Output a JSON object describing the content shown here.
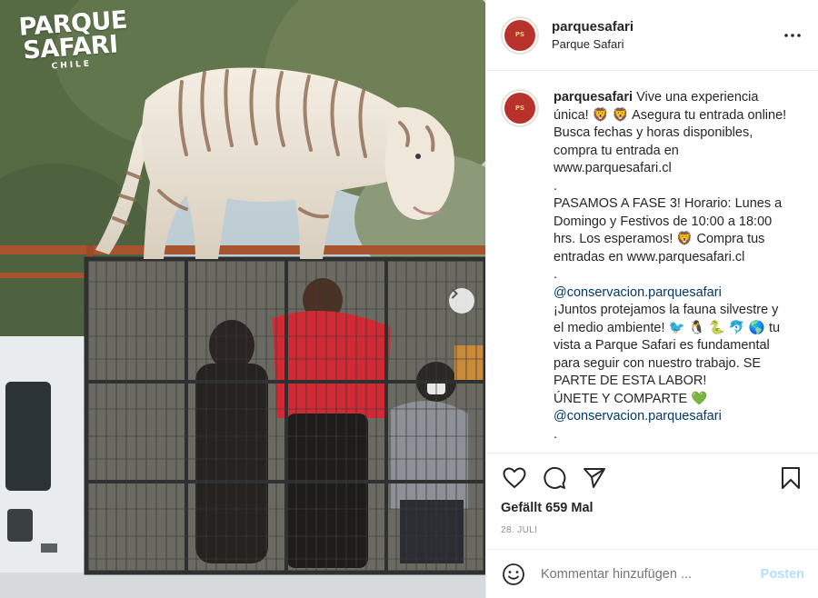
{
  "post": {
    "username": "parquesafari",
    "display_name": "Parque Safari",
    "avatar_text": "PARQUE SAFARI",
    "brand_logo": {
      "line1": "PARQUE",
      "line2": "SAFARI",
      "line3": "CHILE"
    },
    "caption": {
      "username": "parquesafari",
      "lines": [
        "Vive una experiencia única! 🦁 🦁 Asegura tu entrada online! Busca fechas y horas disponibles, compra tu entrada en www.parquesafari.cl",
        ".",
        "PASAMOS A FASE 3! Horario: Lunes a Domingo y Festivos de 10:00 a 18:00 hrs. Los esperamos! 🦁 Compra tus entradas en www.parquesafari.cl",
        ".",
        "@conservacion.parquesafari",
        "¡Juntos protejamos la fauna silvestre y el medio ambiente! 🐦 🐧 🐍 🐬 🌎 tu vista a Parque Safari es fundamental para seguir con nuestro trabajo. SE PARTE DE ESTA LABOR!",
        "ÚNETE Y COMPARTE 💚",
        "@conservacion.parquesafari",
        "."
      ]
    },
    "likes": "Gefällt 659 Mal",
    "date": "28. JULI"
  },
  "comment_box": {
    "placeholder": "Kommentar hinzufügen ...",
    "post_label": "Posten"
  },
  "icons": {
    "more": "more-options-icon",
    "like": "heart-icon",
    "comment": "comment-icon",
    "share": "paper-plane-icon",
    "save": "bookmark-icon",
    "emoji": "smiley-icon",
    "next": "chevron-right-icon"
  },
  "colors": {
    "link": "#00376b",
    "post_button": "#b2dffc",
    "avatar_red": "#b8322b",
    "muted": "#8e8e8e"
  }
}
